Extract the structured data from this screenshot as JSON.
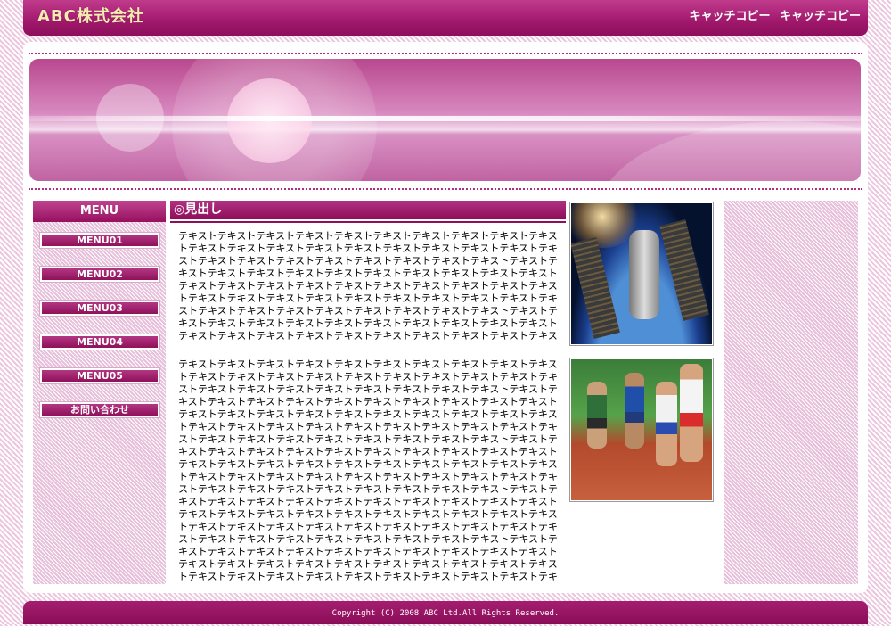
{
  "header": {
    "logo": "ABC株式会社",
    "catchcopy": [
      "キャッチコピー",
      "キャッチコピー"
    ]
  },
  "sidebar": {
    "title": "MENU",
    "items": [
      {
        "label": "MENU01"
      },
      {
        "label": "MENU02"
      },
      {
        "label": "MENU03"
      },
      {
        "label": "MENU04"
      },
      {
        "label": "MENU05"
      },
      {
        "label": "お問い合わせ"
      }
    ]
  },
  "content": {
    "heading": "◎見出し",
    "paragraph1": "テキストテキストテキストテキストテキストテキストテキストテキストテキストテキストテキストテキストテキストテキストテキストテキストテキストテキストテキストテキストテキストテキストテキストテキストテキストテキストテキストテキストテキストテキストテキストテキストテキストテキストテキストテキストテキストテキストテキストテキストテキストテキストテキストテキストテキストテキストテキストテキストテキストテキストテキストテキストテキストテキストテキストテキストテキストテキストテキストテキストテキストテキストテキストテキストテキストテキストテキストテキストテキストテキストテキストテキストテキストテキストテキストテキストテキストテキストテキストテキストテキストテキストテキストテキストテキストテキストテキストテキストテキスト",
    "paragraph2": "テキストテキストテキストテキストテキストテキストテキストテキストテキストテキストテキストテキストテキストテキストテキストテキストテキストテキストテキストテキストテキストテキストテキストテキストテキストテキストテキストテキストテキストテキストテキストテキストテキストテキストテキストテキストテキストテキストテキストテキストテキストテキストテキストテキストテキストテキストテキストテキストテキストテキストテキストテキストテキストテキストテキストテキストテキストテキストテキストテキストテキストテキストテキストテキストテキストテキストテキストテキストテキストテキストテキストテキストテキストテキストテキストテキストテキストテキストテキストテキストテキストテキストテキストテキストテキストテキストテキストテキストテキストテキストテキストテキストテキストテキストテキストテキストテキストテキストテキストテキストテキストテキストテキストテキストテキストテキストテキストテキストテキストテキストテキストテキストテキストテキストテキストテキストテキストテキストテキストテキストテキストテキストテキストテキストテキストテキストテキストテキストテキストテキストテキストテキストテキストテキストテキストテキストテキストテキストテキストテキストテキストテキストテキストテキストテキストテキストテキストテキストテキストテキストテキストテキストテキストテキストテキストテキストテキストテキストテキストテキストテキストテキストテキストテキストテキストテキストテキストテキストテキストテキストテキストテキストテキストテキストテキストテキストテキストテキストテキストテキストテキストテキストテキストテキストテキストテキストテキストテキストテキストテキストテキストテキストテキストテキストテキストテキストテキストテキストテキストテキストテキストテキストテキスト"
  },
  "footer": {
    "copyright": "Copyright (C) 2008 ABC Ltd.All Rights Reserved."
  },
  "colors": {
    "primary": "#9c1566",
    "background": "#f2d8ea"
  }
}
